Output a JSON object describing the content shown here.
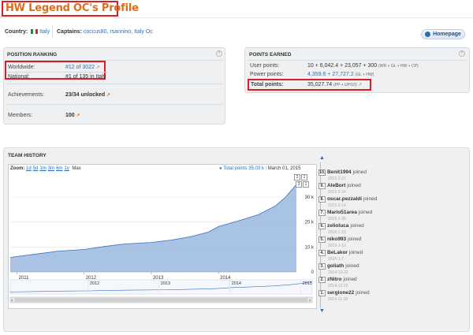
{
  "header": {
    "title": "HW Legend OC's Profile"
  },
  "info": {
    "country_label": "Country:",
    "country_value": "Italy",
    "captains_label": "Captains:",
    "captains_value": "coccus80, rsannino, Italy Oc",
    "homepage_label": "Homepage"
  },
  "ranking": {
    "title": "POSITION RANKING",
    "worldwide_label": "Worldwide:",
    "worldwide_value": "#12 of 3022",
    "national_label": "National:",
    "national_value": "#1 of 135 in Italy",
    "achievements_label": "Achievements:",
    "achievements_value": "23/34 unlocked",
    "members_label": "Members:",
    "members_value": "100"
  },
  "points": {
    "title": "POINTS EARNED",
    "user_label": "User points:",
    "user_value": "10 + 6,042.4 + 23,057 + 300",
    "user_note": "(WR + GL + HW + CP)",
    "power_label": "Power points:",
    "power_value": "4,359.6 + 27,727.2",
    "power_note": "(GL + HW)",
    "total_label": "Total points:",
    "total_value": "35,027.74",
    "total_note": "(PP + UP/10)"
  },
  "team_history": {
    "title": "TEAM HISTORY",
    "zoom_label": "Zoom:",
    "zoom_options": [
      "1d",
      "5d",
      "1m",
      "3m",
      "6m",
      "1y"
    ],
    "zoom_max": "Max",
    "legend_text": "Total points 35.03 k",
    "legend_date": "March 01, 2015",
    "nav_buttons": [
      "2",
      "1",
      "3",
      "1"
    ]
  },
  "chart_data": {
    "type": "area",
    "series": [
      {
        "name": "Total points",
        "x": [
          2010.9,
          2011.0,
          2011.3,
          2011.6,
          2012.0,
          2012.3,
          2012.6,
          2013.0,
          2013.3,
          2013.6,
          2013.85,
          2014.0,
          2014.3,
          2014.6,
          2014.85,
          2015.0,
          2015.16
        ],
        "values": [
          5800,
          6200,
          7200,
          8300,
          9000,
          10200,
          11200,
          11800,
          12800,
          14200,
          16000,
          18200,
          20500,
          23000,
          26500,
          30000,
          35030
        ]
      }
    ],
    "x_ticks": [
      "2011",
      "2012",
      "2013",
      "2014"
    ],
    "y_ticks": [
      "0",
      "10 k",
      "20 k",
      "30 k"
    ],
    "ylim": [
      0,
      36000
    ],
    "xlim": [
      2010.9,
      2015.16
    ],
    "navigator_ticks": [
      "2012",
      "2013",
      "2014",
      "2015"
    ],
    "grid": true,
    "color": "#9ab8e0",
    "line_color": "#3b6fc0"
  },
  "joins": [
    {
      "rank": "10.",
      "name": "Benit1994",
      "action": "joined",
      "date": "2015-2-27"
    },
    {
      "rank": "9.",
      "name": "AleBort",
      "action": "joined",
      "date": "2015-2-24"
    },
    {
      "rank": "8.",
      "name": "oscar.pezzaldi",
      "action": "joined",
      "date": "2015-2-14"
    },
    {
      "rank": "7.",
      "name": "Mario51area",
      "action": "joined",
      "date": "2015-1-28"
    },
    {
      "rank": "6.",
      "name": "zelioluca",
      "action": "joined",
      "date": "2015-1-15"
    },
    {
      "rank": "5.",
      "name": "niko993",
      "action": "joined",
      "date": "2015-1-10"
    },
    {
      "rank": "4.",
      "name": "BeLakor",
      "action": "joined",
      "date": "2015-1-7"
    },
    {
      "rank": "3.",
      "name": "goliath",
      "action": "joined",
      "date": "2014-12-22"
    },
    {
      "rank": "2.",
      "name": "zNitro",
      "action": "joined",
      "date": "2014-12-22"
    },
    {
      "rank": "1.",
      "name": "sergione22",
      "action": "joined",
      "date": "2014-11-29"
    }
  ],
  "colors": {
    "title": "#e06c1a",
    "highlight": "#d81f26",
    "link": "#2a6db5"
  }
}
